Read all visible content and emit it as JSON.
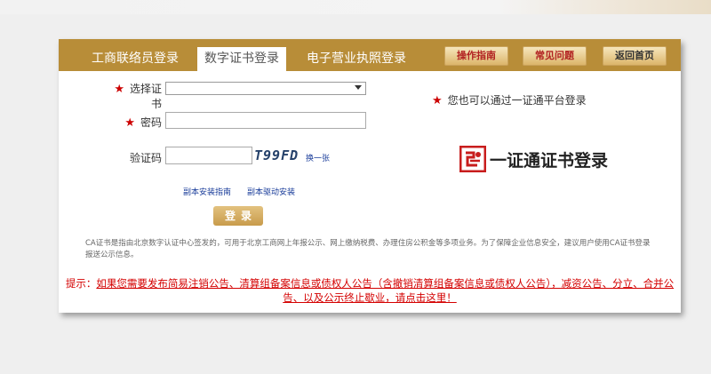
{
  "tabs": {
    "business": "工商联络员登录",
    "cert": "数字证书登录",
    "license": "电子营业执照登录"
  },
  "top_buttons": {
    "guide": "操作指南",
    "faq": "常见问题",
    "home": "返回首页"
  },
  "form": {
    "select_cert_label": "选择证书",
    "password_label": "密码",
    "captcha_label": "验证码",
    "captcha_code": "T99FD",
    "refresh_captcha": "换一张",
    "install_guide": "副本安装指南",
    "driver_install": "副本驱动安装",
    "login_button": "登录"
  },
  "right": {
    "alt_login_note": "您也可以通过一证通平台登录",
    "yzt_label": "一证通证书登录"
  },
  "note": "CA证书是指由北京数字认证中心签发的，可用于北京工商网上年报公示、网上缴纳税费、办理住房公积金等多项业务。为了保障企业信息安全，建议用户使用CA证书登录报送公示信息。",
  "hint": {
    "prefix": "提示：",
    "text": "如果您需要发布简易注销公告、清算组备案信息或债权人公告（含撤销清算组备案信息或债权人公告），减资公告、分立、合并公告、以及公示终止歇业，请点击这里！"
  },
  "colors": {
    "tab_bar": "#b88d38",
    "hint_red": "#d40000",
    "button_text": "#b22222"
  }
}
